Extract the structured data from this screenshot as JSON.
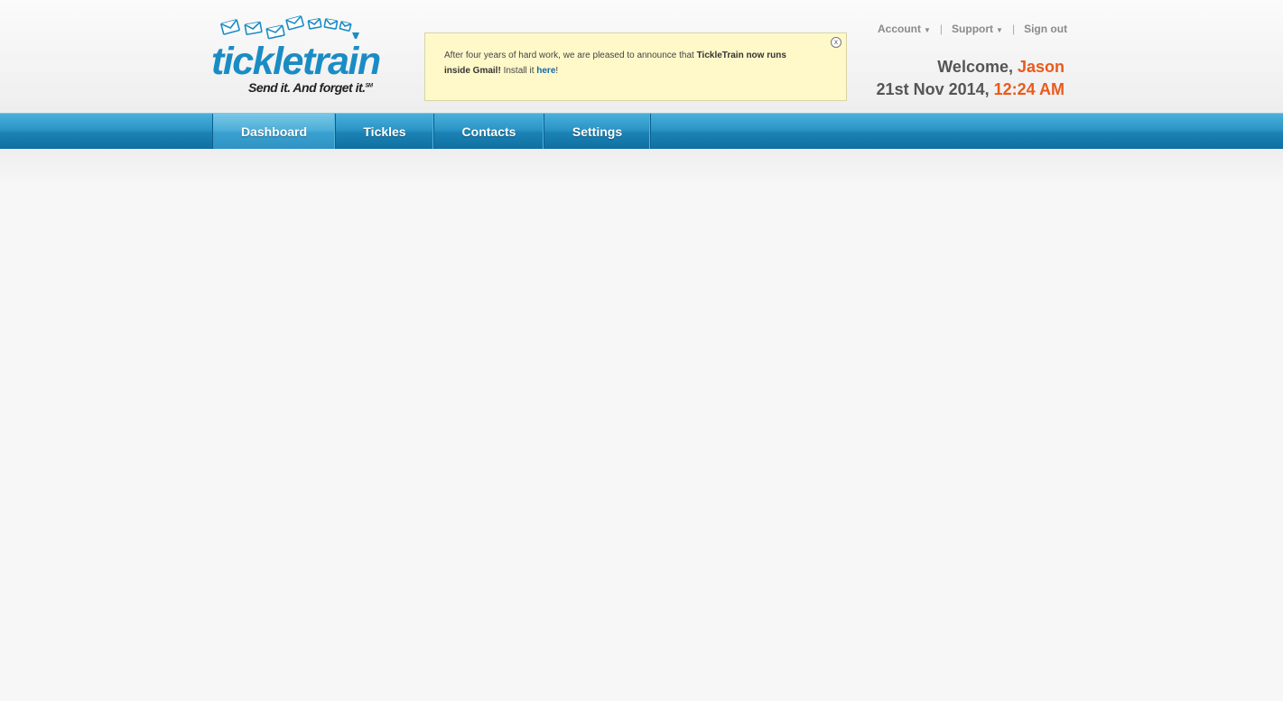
{
  "logo": {
    "wordmark": "tickletrain",
    "tagline": "Send it.  And forget it.",
    "tagline_mark": "SM",
    "brand_color": "#1a8cc4"
  },
  "announcement": {
    "text_before": "After four years of hard work, we are pleased to announce that ",
    "text_bold": "TickleTrain now runs inside Gmail!",
    "text_middle": " Install it ",
    "link_label": "here",
    "text_after": "!",
    "close_label": "x",
    "background": "#fff9c9"
  },
  "top_links": {
    "account": "Account",
    "support": "Support",
    "signout": "Sign out",
    "caret_icon": "caret-down-icon"
  },
  "welcome": {
    "greeting": "Welcome, ",
    "user_name": "Jason",
    "date": "21st Nov 2014, ",
    "time": "12:24 AM",
    "highlight_color": "#ea5a1c"
  },
  "nav": {
    "items": [
      {
        "label": "Dashboard",
        "active": true
      },
      {
        "label": "Tickles",
        "active": false
      },
      {
        "label": "Contacts",
        "active": false
      },
      {
        "label": "Settings",
        "active": false
      }
    ],
    "color": "#1c82b5"
  }
}
